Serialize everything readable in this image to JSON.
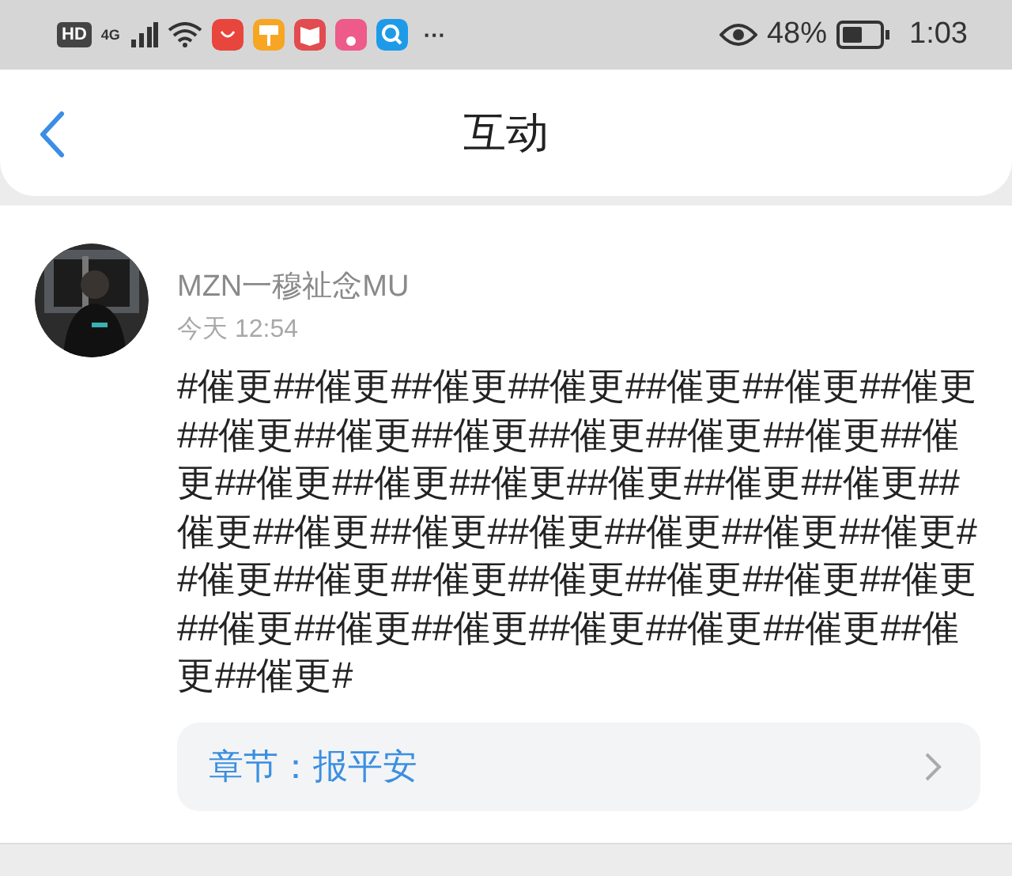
{
  "status_bar": {
    "badges": [
      "HD",
      "4G"
    ],
    "more": "···",
    "battery": "48%",
    "time": "1:03"
  },
  "header": {
    "title": "互动"
  },
  "post": {
    "author": "MZN一穆祉念MU",
    "time": "今天 12:54",
    "content": "#催更##催更##催更##催更##催更##催更##催更##催更##催更##催更##催更##催更##催更##催更##催更##催更##催更##催更##催更##催更##催更##催更##催更##催更##催更##催更##催更##催更##催更##催更##催更##催更##催更##催更##催更##催更##催更##催更##催更##催更##催更##催更#",
    "chapter": {
      "label": "章节：报平安"
    }
  }
}
